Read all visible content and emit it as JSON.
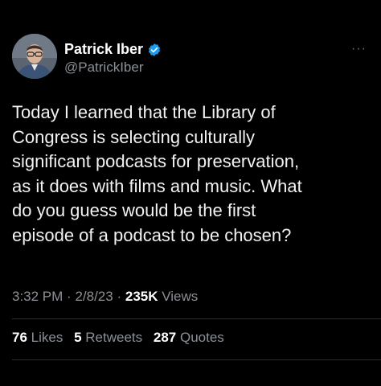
{
  "author": {
    "name": "Patrick Iber",
    "handle": "@PatrickIber",
    "verified_color": "#1d9bf0"
  },
  "tweet": {
    "lines": [
      "Today I learned that the Library of",
      "Congress is selecting culturally",
      "significant podcasts for preservation,",
      "as it does with films and music. What",
      "do you guess would be the first",
      "episode of a podcast to be chosen?"
    ]
  },
  "meta": {
    "time": "3:32 PM",
    "separator": "·",
    "date": "2/8/23",
    "views_count": "235K",
    "views_label": "Views"
  },
  "stats": {
    "likes_count": "76",
    "likes_label": "Likes",
    "retweets_count": "5",
    "retweets_label": "Retweets",
    "quotes_count": "287",
    "quotes_label": "Quotes"
  },
  "icons": {
    "more": "more-options-icon",
    "verified": "verified-badge-icon"
  },
  "more_glyph": "···"
}
